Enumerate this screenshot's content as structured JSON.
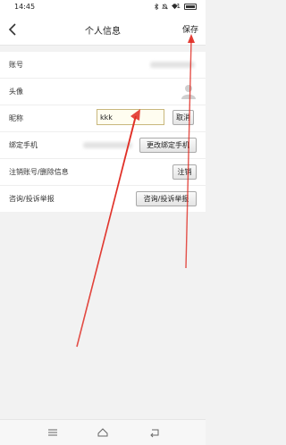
{
  "status_bar": {
    "time": "14:45",
    "battery_level": "61",
    "icons": [
      "bluetooth-icon",
      "mute-icon",
      "wifi-icon",
      "battery-icon"
    ]
  },
  "header": {
    "back_icon": "chevron-left-icon",
    "title": "个人信息",
    "save_label": "保存"
  },
  "rows": {
    "account": {
      "label": "账号"
    },
    "avatar": {
      "label": "头像",
      "icon": "avatar-icon"
    },
    "nickname": {
      "label": "昵称",
      "input_value": "kkk",
      "cancel_label": "取消"
    },
    "phone": {
      "label": "绑定手机",
      "change_label": "更改绑定手机"
    },
    "deregister": {
      "label": "注销账号/删除信息",
      "action_label": "注销"
    },
    "complaint": {
      "label": "咨询/投诉举报",
      "action_label": "咨询/投诉举报"
    }
  },
  "nav_bar": {
    "icons": [
      "menu-icon",
      "home-icon",
      "back-icon"
    ]
  },
  "colors": {
    "annotation": "#e0281f",
    "input_border": "#c8b77c",
    "background": "#f2f2f2"
  }
}
